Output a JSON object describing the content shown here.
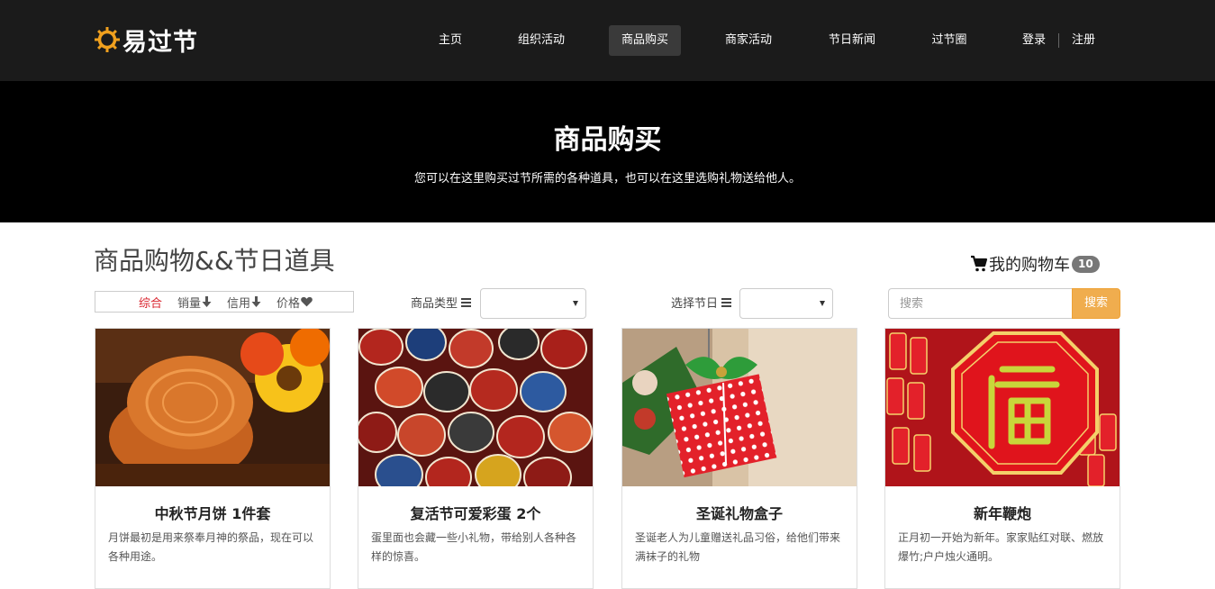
{
  "brand": {
    "name": "易过节",
    "icon": "sun-logo-icon",
    "color": "#f0a01e"
  },
  "nav": {
    "items": [
      {
        "label": "主页"
      },
      {
        "label": "组织活动"
      },
      {
        "label": "商品购买",
        "active": true
      },
      {
        "label": "商家活动"
      },
      {
        "label": "节日新闻"
      },
      {
        "label": "过节圈"
      }
    ],
    "login": "登录",
    "register": "注册"
  },
  "hero": {
    "title": "商品购买",
    "subtitle": "您可以在这里购买过节所需的各种道具，也可以在这里选购礼物送给他人。"
  },
  "section": {
    "title": "商品购物&&节日道具"
  },
  "cart": {
    "label": "我的购物车",
    "count": "10",
    "icon": "shopping-cart-icon"
  },
  "sort": {
    "items": [
      {
        "label": "综合",
        "active": true,
        "icon": null
      },
      {
        "label": "销量",
        "icon": "arrow-down-icon"
      },
      {
        "label": "信用",
        "icon": "arrow-down-icon"
      },
      {
        "label": "价格",
        "icon": "heart-icon"
      }
    ],
    "active_color": "#d9232d"
  },
  "filters": {
    "type_label": "商品类型",
    "type_value": "",
    "festival_label": "选择节日",
    "festival_value": ""
  },
  "search": {
    "placeholder": "搜索",
    "button": "搜索",
    "button_color": "#f0ad4e"
  },
  "products": [
    {
      "title": "中秋节月饼 1件套",
      "desc": "月饼最初是用来祭奉月神的祭品，现在可以各种用途。",
      "image": "mooncake-image"
    },
    {
      "title": "复活节可爱彩蛋 2个",
      "desc": "蛋里面也会藏一些小礼物，带给别人各种各样的惊喜。",
      "image": "easter-eggs-image"
    },
    {
      "title": "圣诞礼物盒子",
      "desc": "圣诞老人为儿童赠送礼品习俗，给他们带来满袜子的礼物",
      "image": "christmas-gift-image"
    },
    {
      "title": "新年鞭炮",
      "desc": "正月初一开始为新年。家家贴红对联、燃放爆竹;户户烛火通明。",
      "image": "firecrackers-image"
    }
  ]
}
